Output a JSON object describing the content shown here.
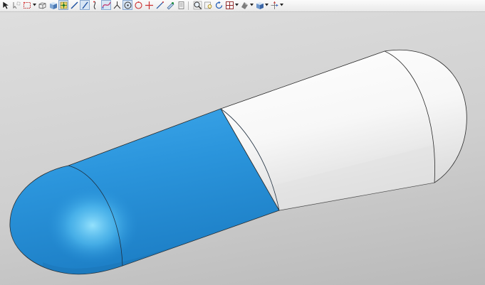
{
  "toolbar": {
    "groups": [
      {
        "items": [
          {
            "id": "select-cursor",
            "icon": "cursor-icon"
          },
          {
            "id": "select-filter",
            "icon": "filter-selection-icon"
          },
          {
            "id": "marquee-select",
            "icon": "dashed-rectangle-icon",
            "dropdown": true
          },
          {
            "id": "wireframe-view",
            "icon": "wireframe-box-icon"
          },
          {
            "id": "shaded-view",
            "icon": "shaded-cube-icon"
          },
          {
            "id": "snap-points",
            "icon": "snap-grid-icon",
            "active": true
          },
          {
            "id": "line-tool",
            "icon": "line-icon"
          },
          {
            "id": "axis-line-tool",
            "icon": "diagonal-line-icon",
            "active": true
          },
          {
            "id": "curve-tool",
            "icon": "curve-icon"
          },
          {
            "id": "spline-tool",
            "icon": "spline-icon",
            "active": true
          },
          {
            "id": "angle-tool",
            "icon": "angle-icon"
          },
          {
            "id": "circle-center-tool",
            "icon": "circle-center-icon",
            "active": true
          },
          {
            "id": "circle-tool",
            "icon": "circle-icon"
          },
          {
            "id": "cross-point-tool",
            "icon": "crosshair-icon"
          },
          {
            "id": "extend-line-tool",
            "icon": "extend-line-icon"
          },
          {
            "id": "measure-tool",
            "icon": "measure-icon"
          },
          {
            "id": "sheet-tool",
            "icon": "sheet-icon"
          }
        ]
      },
      {
        "items": [
          {
            "id": "zoom-fit",
            "icon": "zoom-fit-icon"
          },
          {
            "id": "zoom-window",
            "icon": "zoom-window-icon"
          },
          {
            "id": "rotate-view",
            "icon": "rotate-icon"
          },
          {
            "id": "view-layout",
            "icon": "layout-grid-icon",
            "dropdown": true
          },
          {
            "id": "render-style",
            "icon": "render-style-icon",
            "dropdown": true
          },
          {
            "id": "shaded-cube",
            "icon": "cube-icon",
            "dropdown": true
          },
          {
            "id": "orient-view",
            "icon": "orient-arrows-icon",
            "dropdown": true
          }
        ]
      }
    ]
  },
  "viewport": {
    "background_color": "#d3d3d3",
    "model": {
      "type": "capsule",
      "colors": {
        "blue_cap": "#2e9ae0",
        "blue_highlight": "#7fdcff",
        "white_cap": "#ffffff",
        "white_shadow": "#d6d6d6",
        "edge_lines": "#2a2a2a"
      }
    }
  }
}
